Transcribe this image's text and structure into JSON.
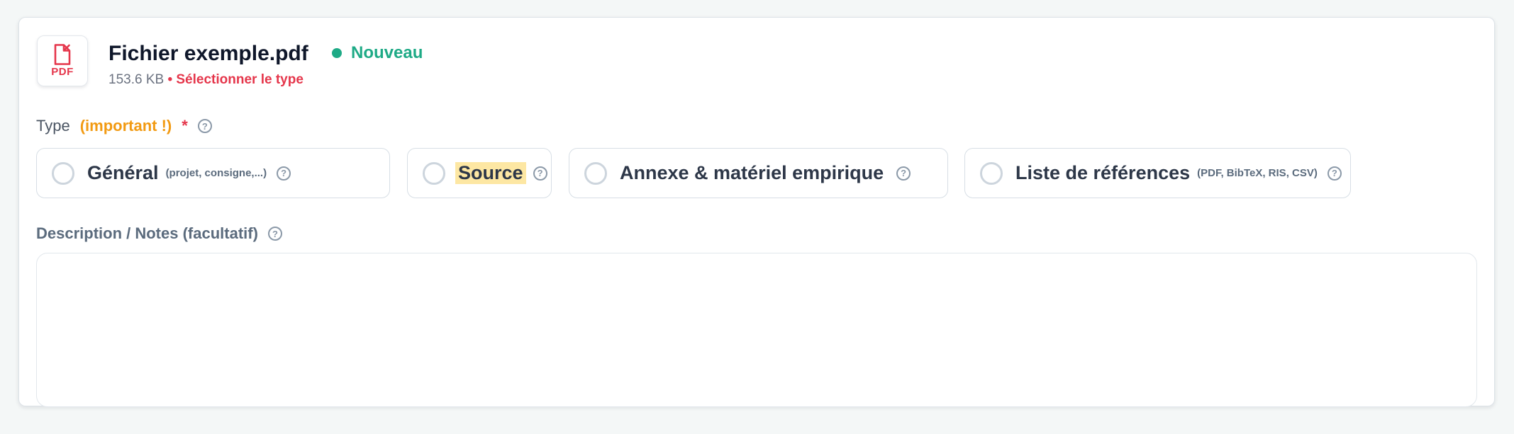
{
  "file": {
    "icon_label": "PDF",
    "name": "Fichier exemple.pdf",
    "status": "Nouveau",
    "size": "153.6 KB",
    "type_warning": "• Sélectionner le type"
  },
  "type_field": {
    "label": "Type",
    "important": "(important !)",
    "required": "*",
    "help": "?",
    "options": [
      {
        "label": "Général",
        "hint": "(projet, consigne,...)",
        "help": "?"
      },
      {
        "label": "Source",
        "hint": "",
        "help": "?"
      },
      {
        "label": "Annexe & matériel empirique",
        "hint": "",
        "help": "?"
      },
      {
        "label": "Liste de références",
        "hint": "(PDF, BibTeX, RIS, CSV)",
        "help": "?"
      }
    ]
  },
  "description": {
    "label": "Description / Notes (facultatif)",
    "help": "?",
    "value": "",
    "placeholder": ""
  },
  "colors": {
    "accent_green": "#1eaa86",
    "warning_red": "#e5364b",
    "important_orange": "#f29a12",
    "highlight_yellow": "#fde7a3"
  },
  "icons": [
    "pdf-file-icon",
    "status-dot-icon",
    "help-icon",
    "radio-icon"
  ]
}
